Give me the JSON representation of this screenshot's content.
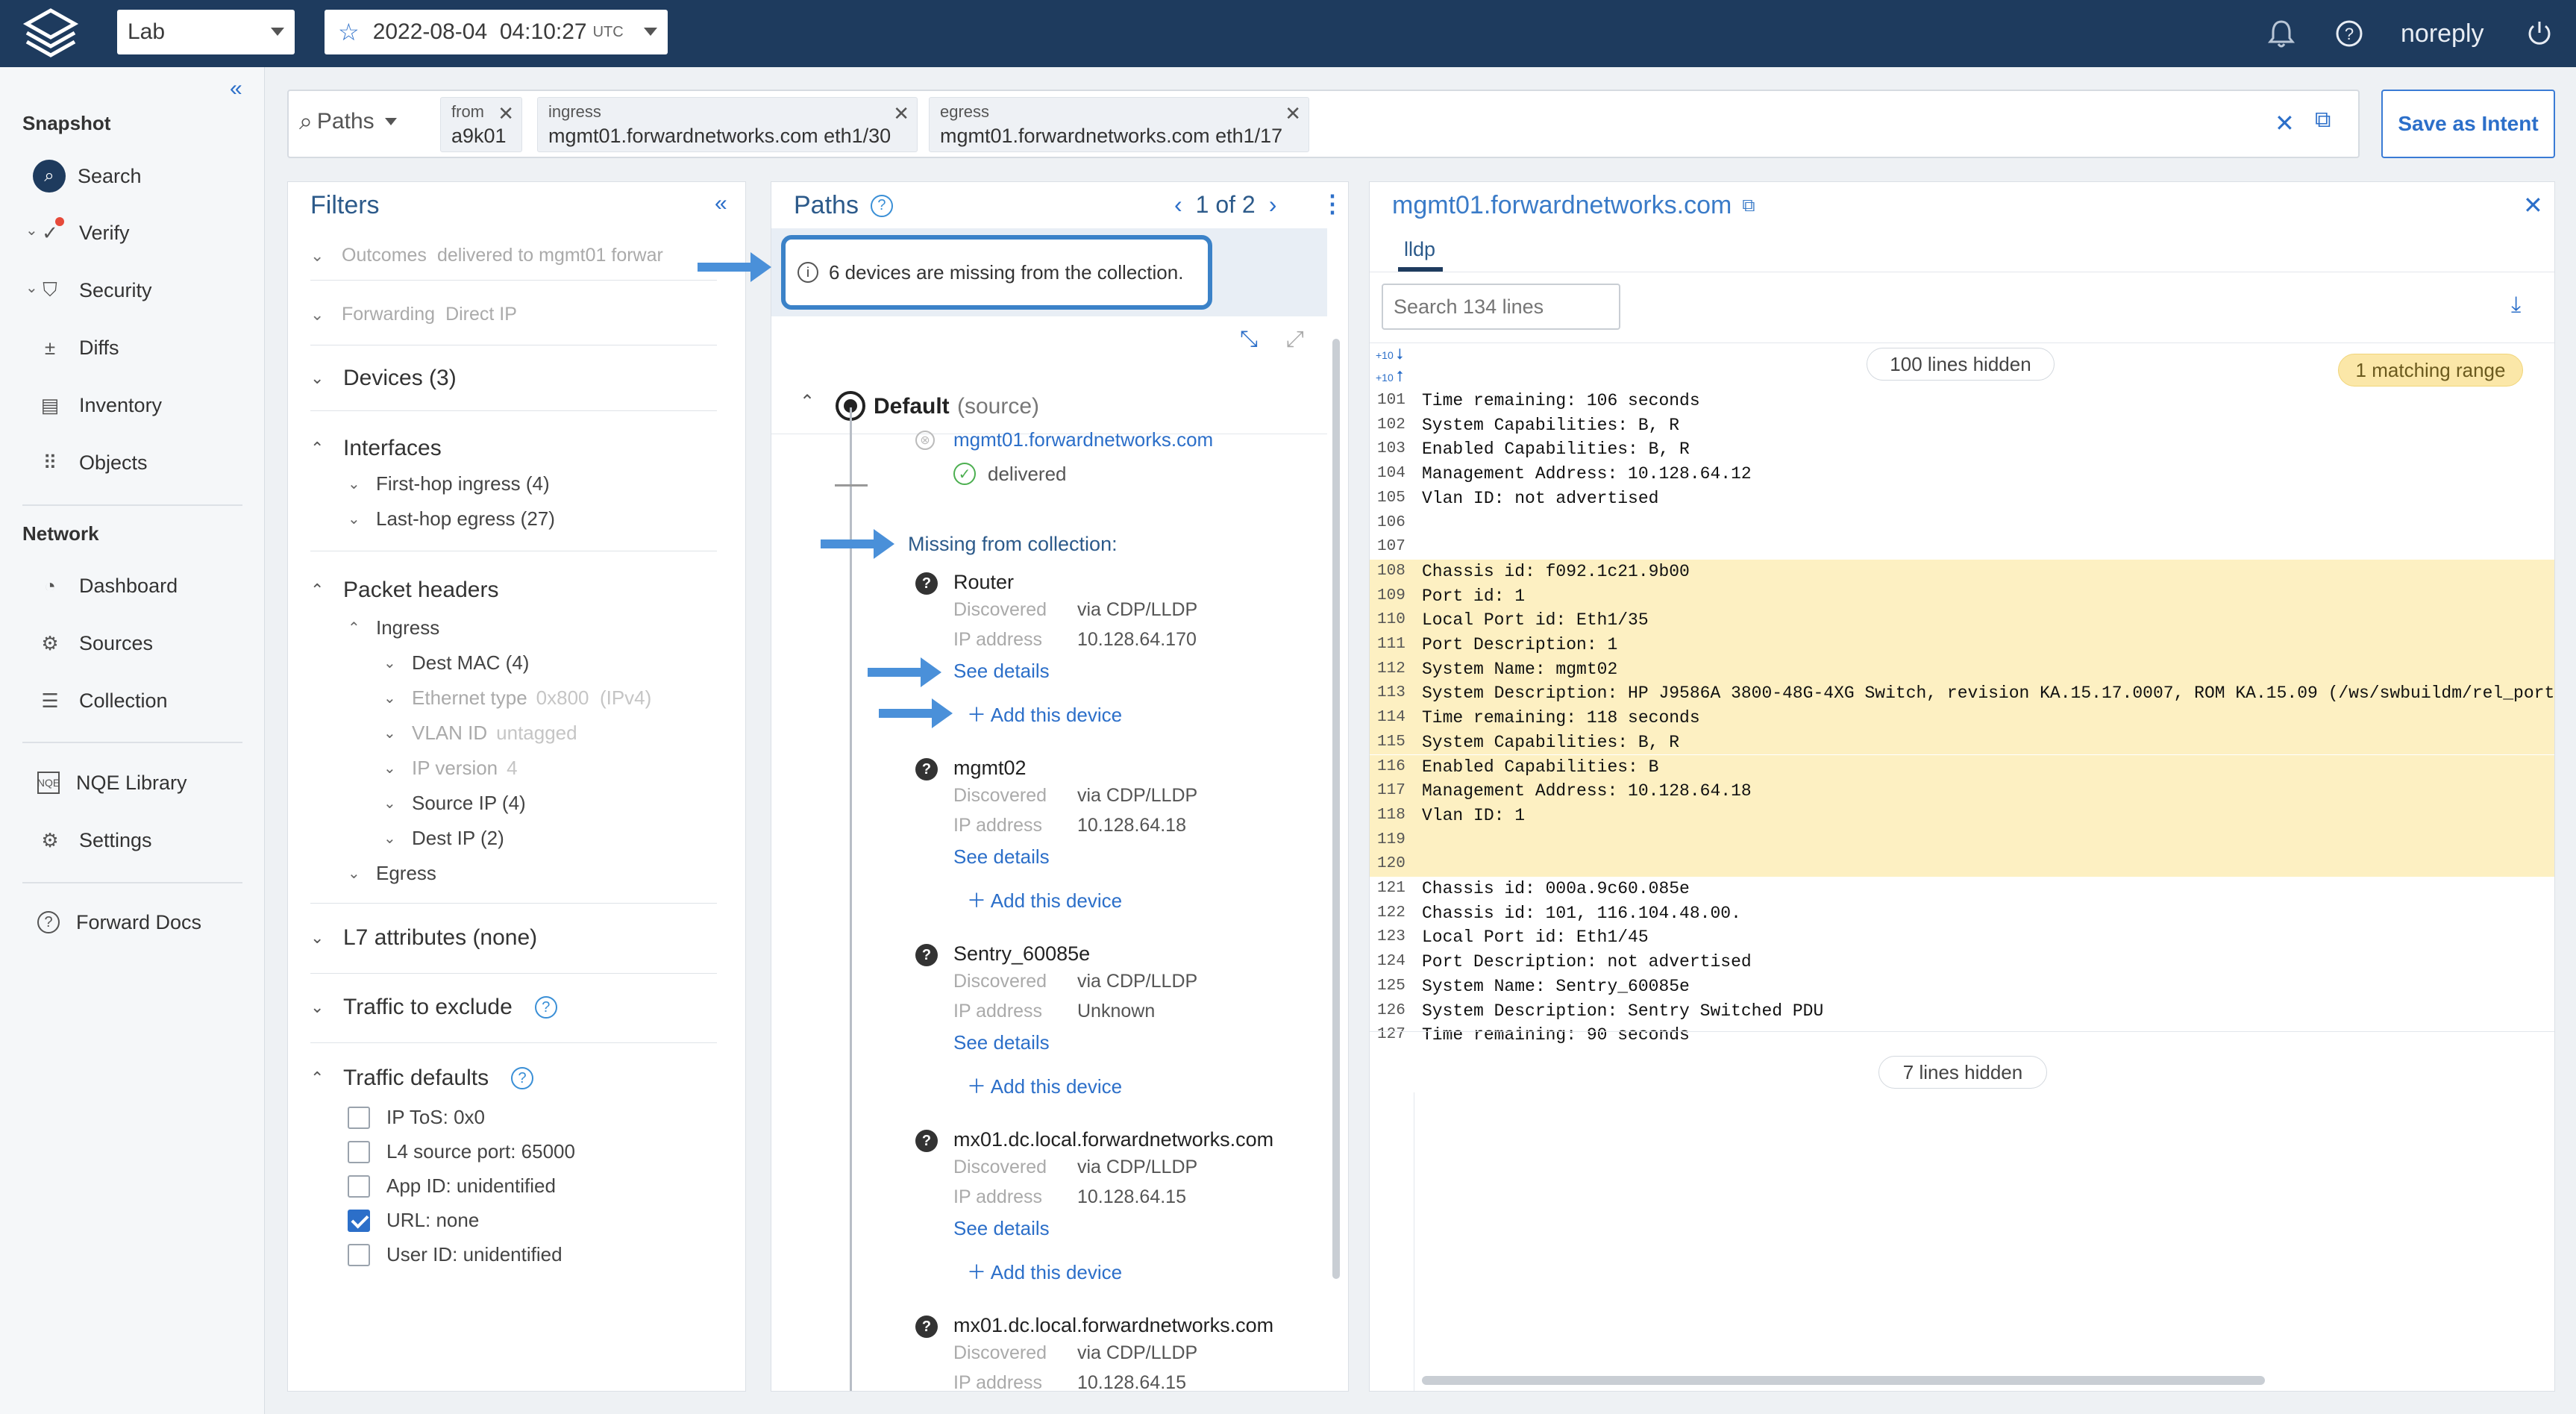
{
  "topbar": {
    "workspace": "Lab",
    "snapshot_date": "2022-08-04  04:10:27",
    "snapshot_tz": "UTC",
    "user": "noreply"
  },
  "sidebar": {
    "snapshot_heading": "Snapshot",
    "snapshot_items": [
      "Search",
      "Verify",
      "Security",
      "Diffs",
      "Inventory",
      "Objects"
    ],
    "network_heading": "Network",
    "network_items": [
      "Dashboard",
      "Sources",
      "Collection"
    ],
    "misc_items": [
      "NQE Library",
      "Settings"
    ],
    "docs": "Forward Docs"
  },
  "search": {
    "mode": "Paths",
    "chips": [
      {
        "key": "from",
        "value": "a9k01"
      },
      {
        "key": "ingress",
        "value": "mgmt01.forwardnetworks.com eth1/30"
      },
      {
        "key": "egress",
        "value": "mgmt01.forwardnetworks.com eth1/17"
      }
    ],
    "save_label": "Save as Intent"
  },
  "filters": {
    "title": "Filters",
    "outcomes_label": "Outcomes",
    "outcomes_value": "delivered to mgmt01 forwar",
    "forwarding_label": "Forwarding",
    "forwarding_value": "Direct IP",
    "devices": "Devices (3)",
    "interfaces": "Interfaces",
    "first_hop": "First-hop ingress (4)",
    "last_hop": "Last-hop egress (27)",
    "packet_headers": "Packet headers",
    "ingress": "Ingress",
    "dest_mac": "Dest MAC (4)",
    "ether_type_label": "Ethernet type",
    "ether_type_value": "0x800  (IPv4)",
    "vlan_label": "VLAN ID",
    "vlan_value": "untagged",
    "ipver_label": "IP version",
    "ipver_value": "4",
    "source_ip": "Source IP (4)",
    "dest_ip": "Dest IP (2)",
    "egress": "Egress",
    "l7": "L7 attributes (none)",
    "traffic_exclude": "Traffic to exclude",
    "traffic_defaults": "Traffic defaults",
    "defaults": [
      {
        "label": "IP ToS: 0x0",
        "checked": false
      },
      {
        "label": "L4 source port: 65000",
        "checked": false
      },
      {
        "label": "App ID: unidentified",
        "checked": false
      },
      {
        "label": "URL: none",
        "checked": true
      },
      {
        "label": "User ID: unidentified",
        "checked": false
      }
    ]
  },
  "paths": {
    "title": "Paths",
    "pager": "1 of 2",
    "banner": "6 devices are missing from the collection.",
    "source_name": "Default",
    "source_suffix": "(source)",
    "first_device": "mgmt01.forwardnetworks.com",
    "delivered": "delivered",
    "missing_heading": "Missing from collection:",
    "discovered_label": "Discovered",
    "ip_label": "IP address",
    "see_details": "See details",
    "add_device": "Add this device",
    "missing": [
      {
        "name": "Router",
        "discovered": "via CDP/LLDP",
        "ip": "10.128.64.170"
      },
      {
        "name": "mgmt02",
        "discovered": "via CDP/LLDP",
        "ip": "10.128.64.18"
      },
      {
        "name": "Sentry_60085e",
        "discovered": "via CDP/LLDP",
        "ip": "Unknown"
      },
      {
        "name": "mx01.dc.local.forwardnetworks.com",
        "discovered": "via CDP/LLDP",
        "ip": "10.128.64.15"
      },
      {
        "name": "mx01.dc.local.forwardnetworks.com",
        "discovered": "via CDP/LLDP",
        "ip": "10.128.64.15"
      }
    ]
  },
  "detail": {
    "title": "mgmt01.forwardnetworks.com",
    "tab": "lldp",
    "search_placeholder": "Search 134 lines",
    "expand_down": "+10",
    "expand_up": "+10",
    "hidden_top": "100 lines hidden",
    "matching": "1 matching range",
    "hidden_bottom": "7 lines hidden",
    "lines": [
      {
        "n": "101",
        "t": "Time remaining: 106 seconds",
        "hl": false
      },
      {
        "n": "102",
        "t": "System Capabilities: B, R",
        "hl": false
      },
      {
        "n": "103",
        "t": "Enabled Capabilities: B, R",
        "hl": false
      },
      {
        "n": "104",
        "t": "Management Address: 10.128.64.12",
        "hl": false
      },
      {
        "n": "105",
        "t": "Vlan ID: not advertised",
        "hl": false
      },
      {
        "n": "106",
        "t": "",
        "hl": false
      },
      {
        "n": "107",
        "t": "",
        "hl": false
      },
      {
        "n": "108",
        "t": "Chassis id: f092.1c21.9b00",
        "hl": true
      },
      {
        "n": "109",
        "t": "Port id: 1",
        "hl": true
      },
      {
        "n": "110",
        "t": "Local Port id: Eth1/35",
        "hl": true
      },
      {
        "n": "111",
        "t": "Port Description: 1",
        "hl": true
      },
      {
        "n": "112",
        "t": "System Name: mgmt02",
        "hl": true
      },
      {
        "n": "113",
        "t": "System Description: HP J9586A 3800-48G-4XG Switch, revision KA.15.17.0007, ROM KA.15.09 (/ws/swbuildm/rel_port",
        "hl": true
      },
      {
        "n": "114",
        "t": "Time remaining: 118 seconds",
        "hl": true
      },
      {
        "n": "115",
        "t": "System Capabilities: B, R",
        "hl": true
      },
      {
        "n": "116",
        "t": "Enabled Capabilities: B",
        "hl": true
      },
      {
        "n": "117",
        "t": "Management Address: 10.128.64.18",
        "hl": true
      },
      {
        "n": "118",
        "t": "Vlan ID: 1",
        "hl": true
      },
      {
        "n": "119",
        "t": "",
        "hl": true
      },
      {
        "n": "120",
        "t": "",
        "hl": true
      },
      {
        "n": "121",
        "t": "Chassis id: 000a.9c60.085e",
        "hl": false
      },
      {
        "n": "122",
        "t": "Chassis id: 101, 116.104.48.00.",
        "hl": false
      },
      {
        "n": "123",
        "t": "Local Port id: Eth1/45",
        "hl": false
      },
      {
        "n": "124",
        "t": "Port Description: not advertised",
        "hl": false
      },
      {
        "n": "125",
        "t": "System Name: Sentry_60085e",
        "hl": false
      },
      {
        "n": "126",
        "t": "System Description: Sentry Switched PDU",
        "hl": false
      },
      {
        "n": "127",
        "t": "Time remaining: 90 seconds",
        "hl": false
      }
    ]
  },
  "colors": {
    "topbar": "#1e3b5e",
    "accent": "#2c6fc9",
    "highlight": "#fdf0c2",
    "callout": "#4a90d9"
  }
}
